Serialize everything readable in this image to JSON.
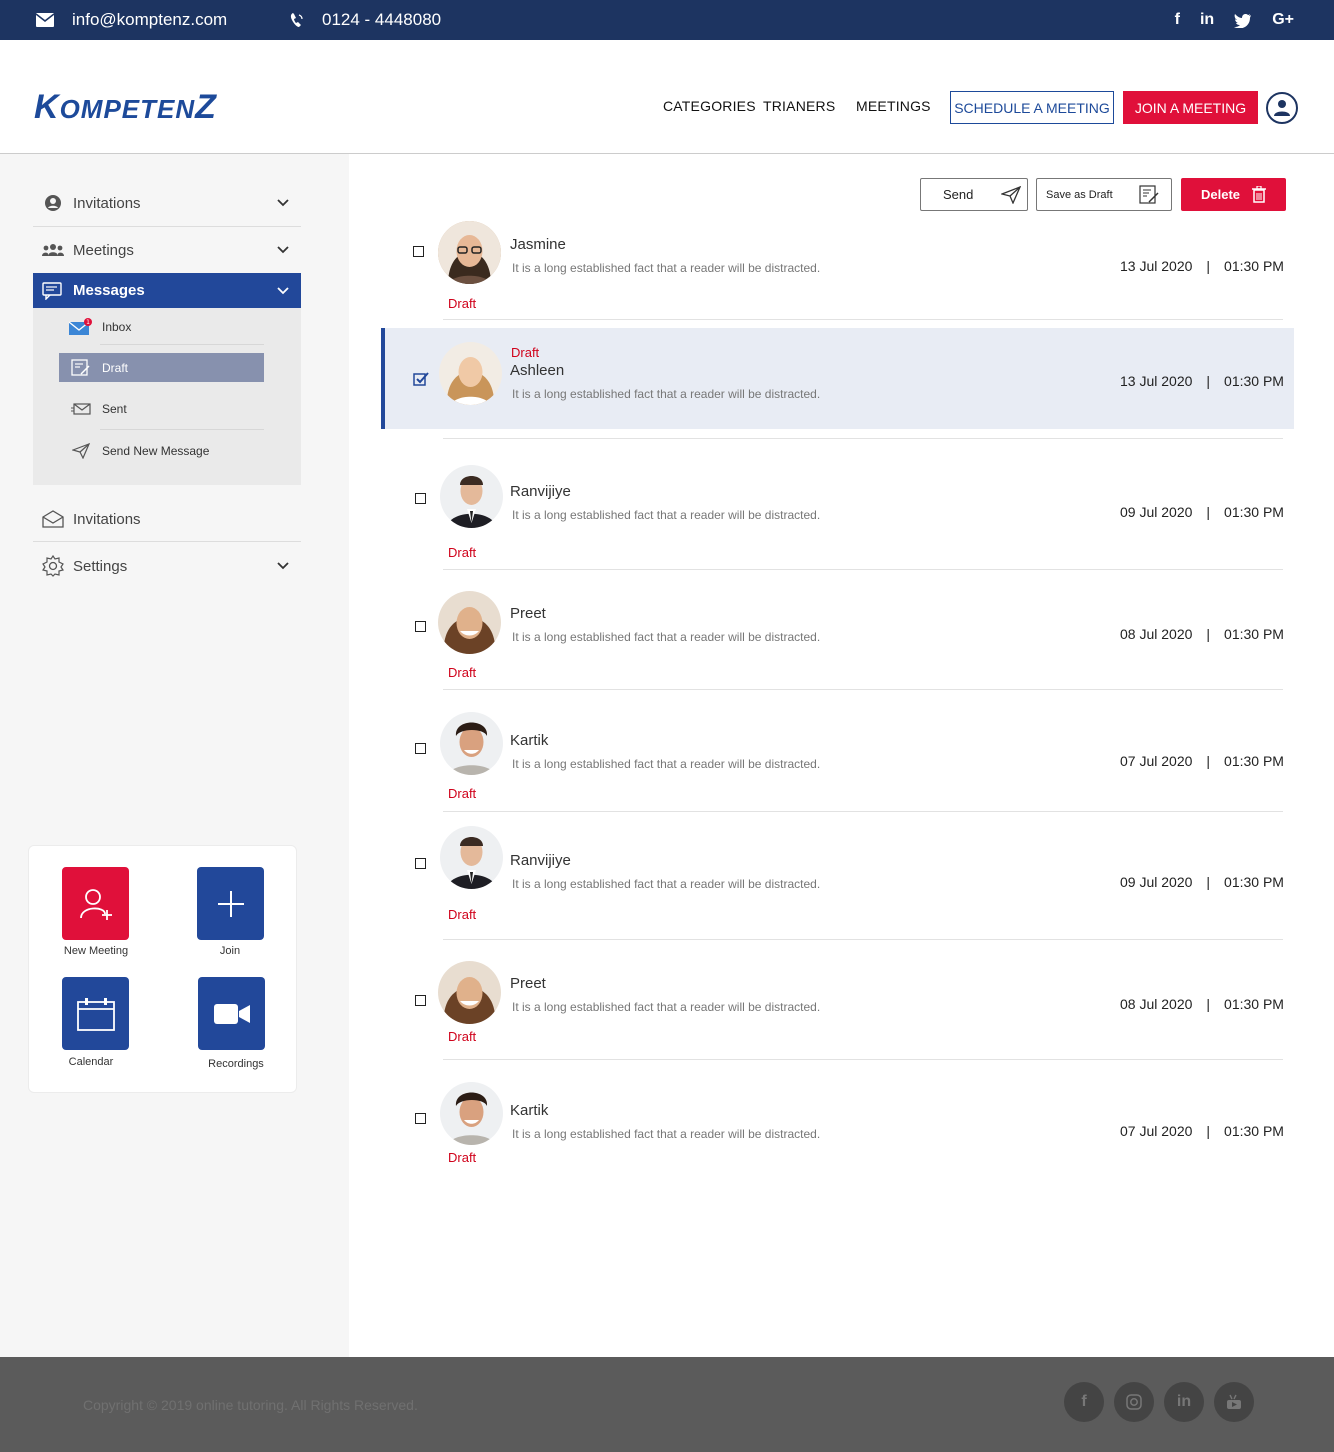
{
  "topbar": {
    "email": "info@komptenz.com",
    "phone": "0124 - 4448080",
    "social": [
      "f",
      "in",
      "twitter",
      "G+"
    ]
  },
  "header": {
    "logo_first": "K",
    "logo_mid": "OMPETEN",
    "logo_last": "Z",
    "nav": [
      "CATEGORIES",
      "TRIANERS",
      "MEETINGS"
    ],
    "schedule_label": "SCHEDULE A MEETING",
    "join_label": "JOIN A MEETING"
  },
  "sidebar": {
    "items": [
      {
        "label": "Invitations"
      },
      {
        "label": "Meetings"
      },
      {
        "label": "Messages"
      },
      {
        "label": "Invitations"
      },
      {
        "label": "Settings"
      }
    ],
    "submenu": [
      {
        "label": "Inbox",
        "badge": "1"
      },
      {
        "label": "Draft"
      },
      {
        "label": "Sent"
      },
      {
        "label": "Send  New Message"
      }
    ],
    "quick": [
      {
        "label": "New Meeting",
        "color": "#e0103a"
      },
      {
        "label": "Join",
        "color": "#22489a"
      },
      {
        "label": "Calendar",
        "color": "#22489a"
      },
      {
        "label": "Recordings",
        "color": "#22489a"
      }
    ]
  },
  "toolbar": {
    "send_label": "Send",
    "save_draft_label": "Save as Draft",
    "delete_label": "Delete"
  },
  "messages": [
    {
      "name": "Jasmine",
      "preview": "It is a long established fact that a reader will be distracted.",
      "status": "Draft",
      "date": "13 Jul 2020",
      "time": "01:30 PM"
    },
    {
      "name": "Ashleen",
      "preview": "It is a long established fact that a reader will be distracted.",
      "status": "Draft",
      "date": "13 Jul 2020",
      "time": "01:30 PM"
    },
    {
      "name": "Ranvijiye",
      "preview": "It is a long established fact that a reader will be distracted.",
      "status": "Draft",
      "date": "09 Jul 2020",
      "time": "01:30 PM"
    },
    {
      "name": "Preet",
      "preview": "It is a long established fact that a reader will be distracted.",
      "status": "Draft",
      "date": "08 Jul 2020",
      "time": "01:30 PM"
    },
    {
      "name": "Kartik",
      "preview": "It is a long established fact that a reader will be distracted.",
      "status": "Draft",
      "date": "07 Jul 2020",
      "time": "01:30 PM"
    },
    {
      "name": "Ranvijiye",
      "preview": "It is a long established fact that a reader will be distracted.",
      "status": "Draft",
      "date": "09 Jul 2020",
      "time": "01:30 PM"
    },
    {
      "name": "Preet",
      "preview": "It is a long established fact that a reader will be distracted.",
      "status": "Draft",
      "date": "08 Jul 2020",
      "time": "01:30 PM"
    },
    {
      "name": "Kartik",
      "preview": "It is a long established fact that a reader will be distracted.",
      "status": "Draft",
      "date": "07 Jul 2020",
      "time": "01:30 PM"
    }
  ],
  "footer": {
    "copyright": "Copyright © 2019 online tutoring. All Rights Reserved.",
    "social": [
      "f",
      "instagram",
      "in",
      "youtube"
    ]
  }
}
